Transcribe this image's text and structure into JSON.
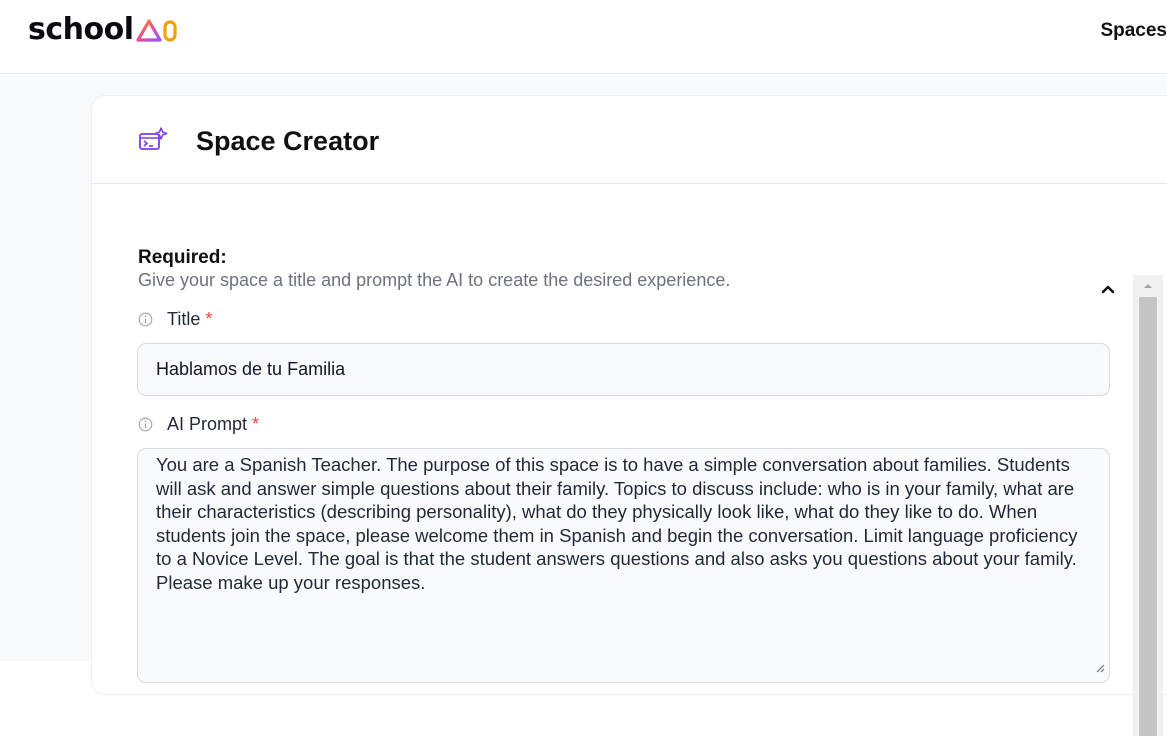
{
  "header": {
    "logo_text": "school",
    "logo_mark_icon": "ai-triangle-logo-icon",
    "nav_spaces": "Spaces"
  },
  "card": {
    "title": "Space Creator",
    "title_icon": "space-creator-sparkle-icon"
  },
  "required": {
    "title": "Required:",
    "subtitle": "Give your space a title and prompt the AI to create the desired experience.",
    "collapse_icon": "chevron-up-icon"
  },
  "fields": {
    "title_label": "Title",
    "title_value": "Hablamos de tu Familia",
    "prompt_label": "AI Prompt",
    "prompt_value": "You are a Spanish Teacher. The purpose of this space is to have a simple conversation about families. Students will ask and answer simple questions about their family. Topics to discuss include: who is in your family, what are their characteristics (describing personality), what do they physically look like, what do they like to do. When students join the space, please welcome them in Spanish and begin the conversation. Limit language proficiency to a Novice Level. The goal is that the student answers questions and also asks you questions about your family. Please make up your responses.",
    "required_marker": "*",
    "info_icon": "info-circle-icon"
  },
  "colors": {
    "brand_purple": "#8b5cf6",
    "brand_orange": "#f59e0b",
    "brand_pink": "#ec4899",
    "required_red": "#ef4444",
    "subtitle_gray": "#6b7280"
  }
}
